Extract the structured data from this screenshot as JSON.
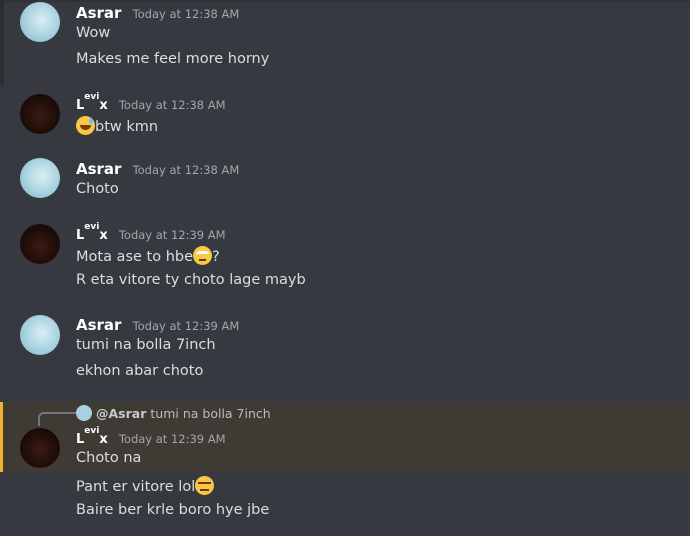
{
  "messages": [
    {
      "user": "Asrar",
      "timestamp": "Today at 12:38 AM",
      "lines": [
        "Wow",
        "Makes me feel more horny"
      ]
    },
    {
      "user": "Levi",
      "timestamp": "Today at 12:38 AM",
      "lines": [
        "btw kmn"
      ],
      "emoji": "sweat-smile"
    },
    {
      "user": "Asrar",
      "timestamp": "Today at 12:38 AM",
      "lines": [
        "Choto"
      ]
    },
    {
      "user": "Levi",
      "timestamp": "Today at 12:39 AM",
      "lines": [
        "Mota ase to hbe",
        "?",
        "R eta vitore ty choto lage mayb"
      ],
      "emoji": "eye-roll"
    },
    {
      "user": "Asrar",
      "timestamp": "Today at 12:39 AM",
      "lines": [
        "tumi na bolla 7inch",
        "ekhon abar choto"
      ]
    },
    {
      "user": "Levi",
      "timestamp": "Today at 12:39 AM",
      "lines": [
        "Choto na",
        "Pant er vitore lol",
        "Baire ber krle boro hye jbe"
      ],
      "emoji": "expressionless",
      "reply": {
        "user": "@Asrar",
        "text": "tumi na bolla 7inch"
      }
    }
  ],
  "levi_name": {
    "l": "L",
    "sup": "evi",
    "x": "ⅹ"
  },
  "colors": {
    "background": "#36393f",
    "highlight": "#3f3b34",
    "mention_bar": "#f0b232"
  }
}
